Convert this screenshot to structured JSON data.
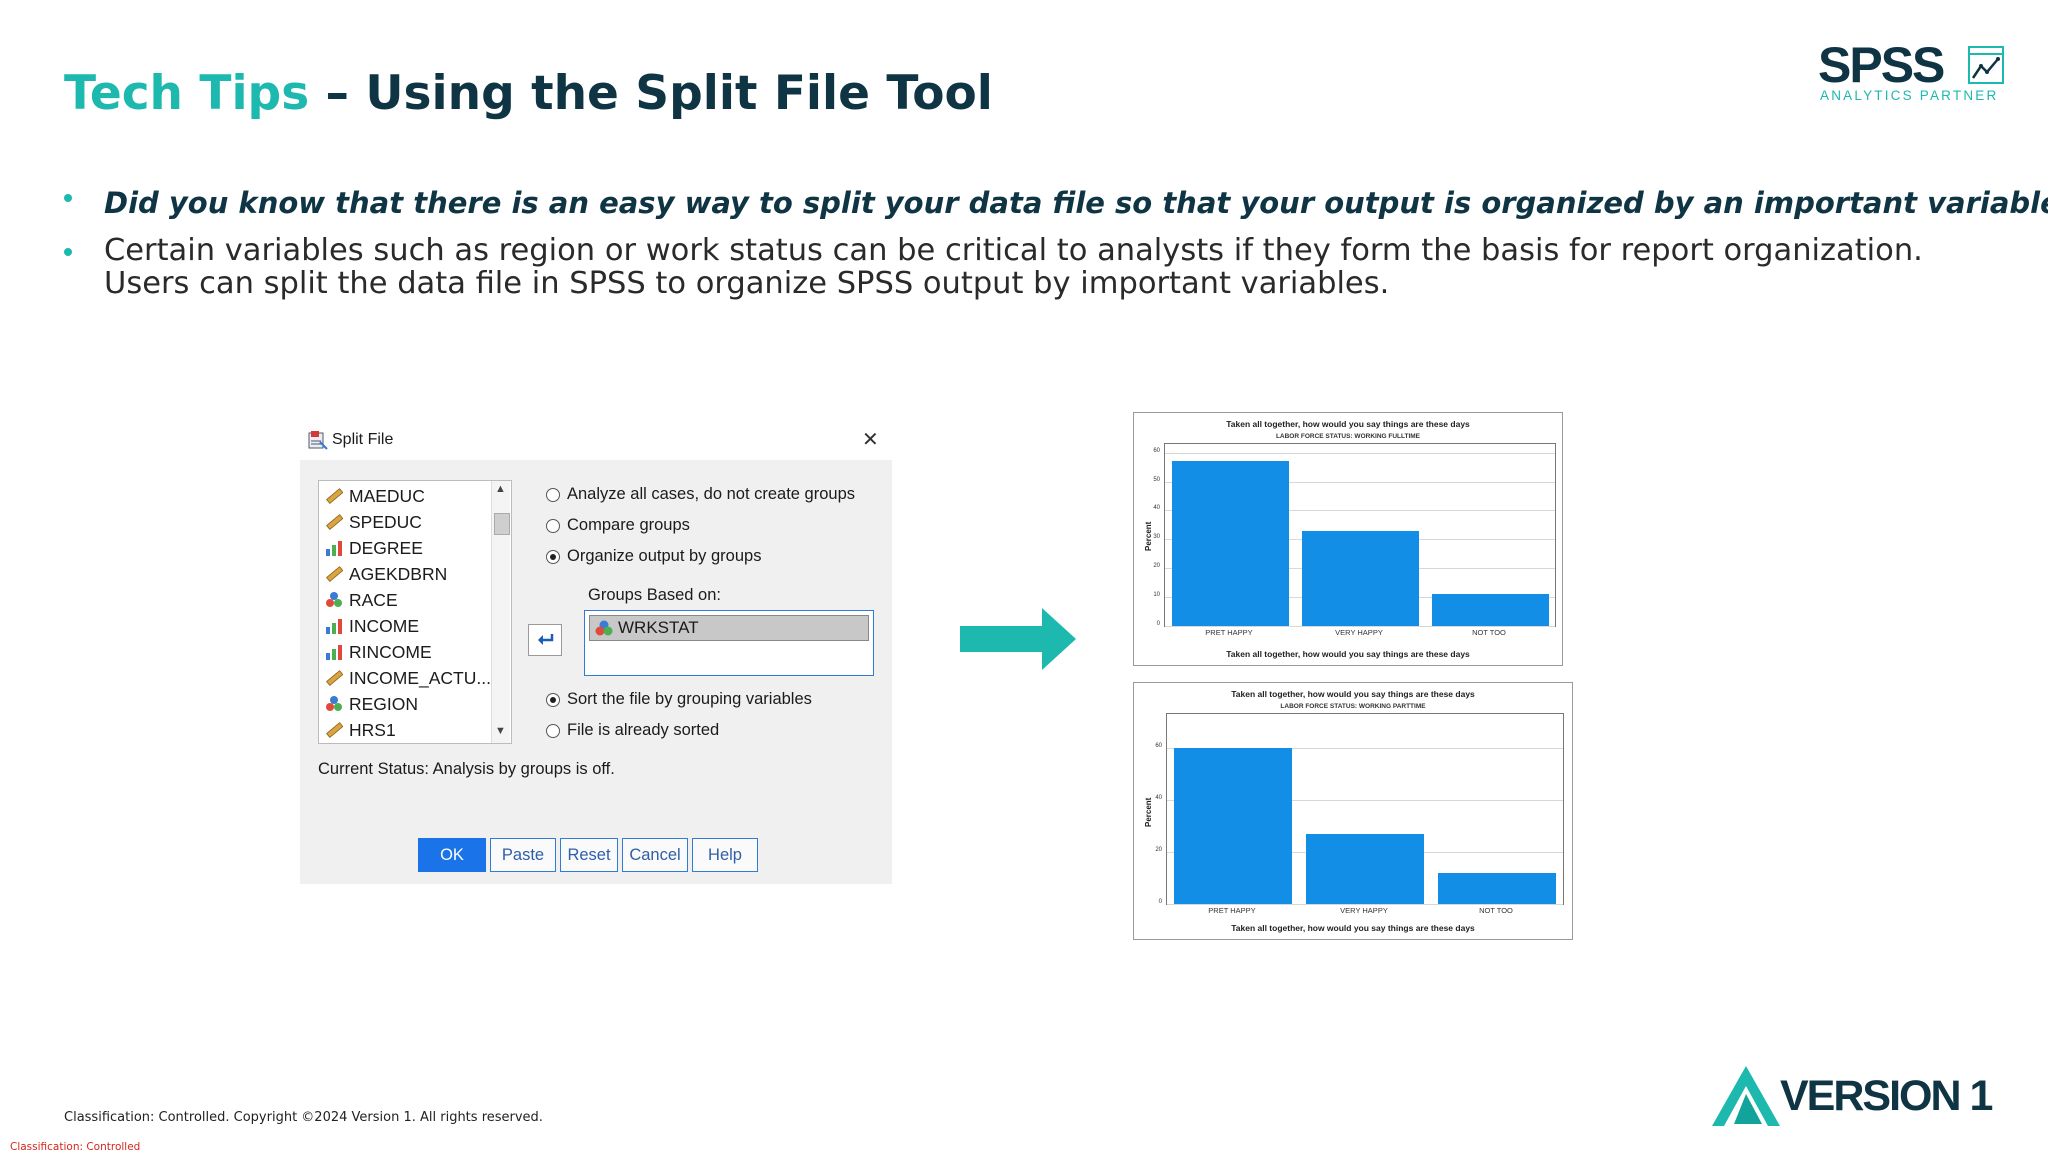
{
  "slide": {
    "title_highlight": "Tech Tips",
    "title_rest": " – Using the Split File Tool",
    "logo": {
      "word": "SPSS",
      "tagline": "ANALYTICS PARTNER"
    },
    "bullets": [
      "Did you know that there is an easy way to split your data file so that your output is organized by an important variable?",
      "Certain variables such as region or work status can be critical to analysts if they form the basis for report organization. Users can split the data file in SPSS to organize SPSS output by important variables."
    ],
    "footer_copyright": "Classification: Controlled. Copyright ©2024 Version 1. All rights reserved.",
    "footer_classification": "Classification: Controlled",
    "brand_logo": "VERSION 1",
    "colors": {
      "accent": "#1db8ae",
      "navy": "#0f3444",
      "bar": "#138ee6",
      "ok_button": "#1a73e8"
    }
  },
  "dialog": {
    "title": "Split File",
    "variables": [
      {
        "name": "MAEDUC",
        "icon": "scale-ruler-icon"
      },
      {
        "name": "SPEDUC",
        "icon": "scale-ruler-icon"
      },
      {
        "name": "DEGREE",
        "icon": "ordinal-bars-icon"
      },
      {
        "name": "AGEKDBRN",
        "icon": "scale-ruler-icon"
      },
      {
        "name": "RACE",
        "icon": "nominal-circles-icon"
      },
      {
        "name": "INCOME",
        "icon": "ordinal-bars-icon"
      },
      {
        "name": "RINCOME",
        "icon": "ordinal-bars-icon"
      },
      {
        "name": "INCOME_ACTU...",
        "icon": "scale-ruler-icon"
      },
      {
        "name": "REGION",
        "icon": "nominal-circles-icon"
      },
      {
        "name": "HRS1",
        "icon": "scale-ruler-icon"
      }
    ],
    "options": {
      "analyze_all": "Analyze all cases, do not create groups",
      "compare": "Compare groups",
      "organize": "Organize output by groups",
      "selected": "organize"
    },
    "groups_based_on_label": "Groups Based on:",
    "groups_based_on": [
      "WRKSTAT"
    ],
    "sort_options": {
      "sort": "Sort the file by grouping variables",
      "sorted": "File is already sorted",
      "selected": "sort"
    },
    "current_status": "Current Status: Analysis by groups is off.",
    "buttons": {
      "ok": "OK",
      "paste": "Paste",
      "reset": "Reset",
      "cancel": "Cancel",
      "help": "Help"
    }
  },
  "chart_data": [
    {
      "type": "bar",
      "title": "Taken all together, how would you say things are these days",
      "subtitle": "LABOR FORCE STATUS: WORKING FULLTIME",
      "xlabel": "Taken all together, how would you say things are these days",
      "ylabel": "Percent",
      "categories": [
        "PRET HAPPY",
        "VERY HAPPY",
        "NOT TOO"
      ],
      "values": [
        57,
        33,
        11
      ],
      "yticks": [
        0,
        10,
        20,
        30,
        40,
        50,
        60
      ],
      "ylim": [
        0,
        63
      ],
      "grid": true
    },
    {
      "type": "bar",
      "title": "Taken all together, how would you say things are these days",
      "subtitle": "LABOR FORCE STATUS: WORKING PARTTIME",
      "xlabel": "Taken all together, how would you say things are these days",
      "ylabel": "Percent",
      "categories": [
        "PRET HAPPY",
        "VERY HAPPY",
        "NOT TOO"
      ],
      "values": [
        60,
        27,
        12
      ],
      "yticks": [
        0,
        20,
        40,
        60
      ],
      "ylim": [
        0,
        73
      ],
      "grid": true
    }
  ]
}
